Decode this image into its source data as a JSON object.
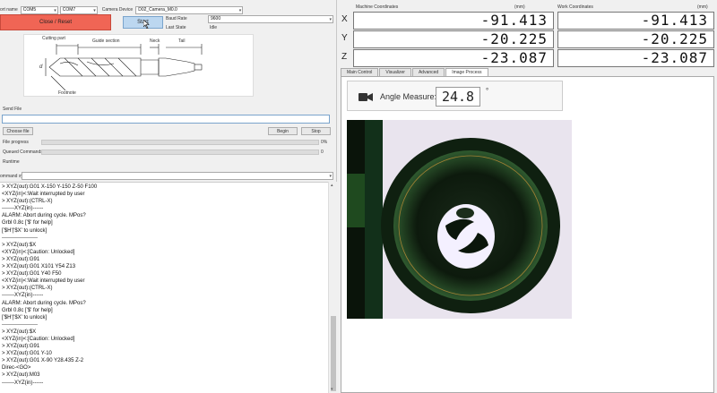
{
  "top": {
    "port_label": "ort name",
    "port_value": "COM5",
    "port2_value": "COM7",
    "camera_label": "Camera Device",
    "camera_value": "D02_Camera_M0.0"
  },
  "connection": {
    "close_reset_label": "Close / Reset",
    "start_label": "Start",
    "baud_label": "Baud Rate",
    "baud_value": "9600",
    "last_state_label": "Last State",
    "last_state_value": "Idle"
  },
  "diagram": {
    "cutting_part": "Cutting part",
    "guide_section": "Guide section",
    "neck": "Neck",
    "tail": "Tail",
    "footnote": "Footnote",
    "d_label": "d"
  },
  "send_file": {
    "section_label": "Send File",
    "choose_file_label": "Choose file",
    "begin_label": "Begin",
    "stop_label": "Stop",
    "file_progress_label": "File progress",
    "file_progress_pct": "0%",
    "file_progress_value": 0,
    "queued_label": "Queued Commands",
    "queued_value": "0",
    "runtime_label": "Runtime"
  },
  "command": {
    "label": "ommand xyz",
    "lines": [
      "> XYZ(out):G01 X-150 Y-150 Z-50 F100",
      "<XYZ(in)<:Wait interrupted by user",
      "> XYZ(out):(CTRL-X)",
      "-------XYZ(in)------",
      "ALARM: Abort during cycle. MPos?",
      "Grbl 0.8c ['$' for help]",
      "['$H'|'$X' to unlock]",
      "--------------------",
      "> XYZ(out):$X",
      "<XYZ(in)<:[Caution: Unlocked]",
      "> XYZ(out):G91",
      "> XYZ(out):G01 X101 Y54 Z13",
      "> XYZ(out):G01 Y40 F50",
      "<XYZ(in)<:Wait interrupted by user",
      "> XYZ(out):(CTRL-X)",
      "-------XYZ(in)------",
      "ALARM: Abort during cycle. MPos?",
      "Grbl 0.8c ['$' for help]",
      "['$H'|'$X' to unlock]",
      "--------------------",
      "> XYZ(out):$X",
      "<XYZ(in)<:[Caution: Unlocked]",
      "> XYZ(out):G91",
      "> XYZ(out):G01 Y-10",
      "> XYZ(out):G01 X-90 Y28.435 Z-2",
      "Direc-<GO>",
      "> XYZ(out):M03",
      "-------XYZ(in)------"
    ]
  },
  "coords": {
    "machine_header": "Machine Coordinates",
    "work_header": "Work Coordinates",
    "unit": "(mm)",
    "x_label": "X",
    "y_label": "Y",
    "z_label": "Z",
    "machine_x": "-91.413",
    "machine_y": "-20.225",
    "machine_z": "-23.087",
    "work_x": "-91.413",
    "work_y": "-20.225",
    "work_z": "-23.087"
  },
  "tabs": {
    "main_control": "Main Control",
    "visualizer": "Visualizer",
    "advanced": "Advanced",
    "image_process": "Image Process"
  },
  "angle": {
    "label": "Angle Measure:",
    "value": "24.8",
    "unit": "°"
  },
  "colors": {
    "close_button": "#f06555",
    "start_button": "#bcd7f0",
    "progress_fill": "#06b025"
  }
}
